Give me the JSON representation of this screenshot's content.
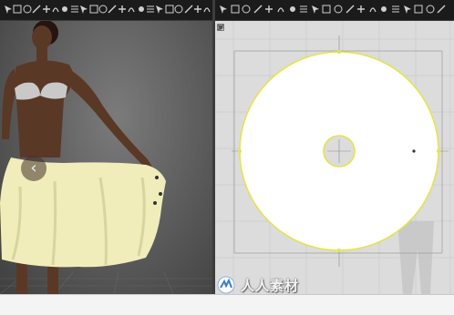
{
  "toolbar_left": {
    "tools": [
      "select-tool-icon",
      "transform-tool-icon",
      "tack-tool-icon",
      "fold-tool-icon",
      "pin-tool-icon",
      "sewing-tool-icon",
      "avatar-tool-icon",
      "measure-tool-icon",
      "undo-icon",
      "fit-tool-icon",
      "brush-icon",
      "hanger-icon",
      "grid-icon",
      "square-tool-icon",
      "lock-icon",
      "strengthen-icon",
      "drape-icon",
      "trash-icon",
      "camera-icon",
      "fabric-icon",
      "texture-icon",
      "refresh-icon"
    ]
  },
  "toolbar_right": {
    "tools": [
      "pattern-select-icon",
      "edit-point-icon",
      "edit-curve-icon",
      "add-point-icon",
      "rectangle-icon",
      "polygon-icon",
      "circle-icon",
      "dart-icon",
      "internal-line-icon",
      "notch-icon",
      "segment-sew-icon",
      "free-sew-icon",
      "elastic-icon",
      "trace-icon",
      "symmetry-icon",
      "fold-arrange-icon",
      "layer-icon",
      "flatten-icon",
      "paint-icon",
      "zoom-icon"
    ]
  },
  "viewport3d": {
    "nav_prev_label": "‹"
  },
  "viewport2d": {
    "side_tools": [
      "pointer-icon",
      "pin-icon",
      "brush-icon",
      "tag-icon"
    ]
  },
  "watermark": {
    "text": "人人素材"
  },
  "colors": {
    "skin": "#5a3826",
    "skirt": "#f0edbb",
    "pattern_fill": "#ffffff",
    "pattern_outline": "#e6e34a",
    "canvas_bg": "#dcdcdc"
  }
}
